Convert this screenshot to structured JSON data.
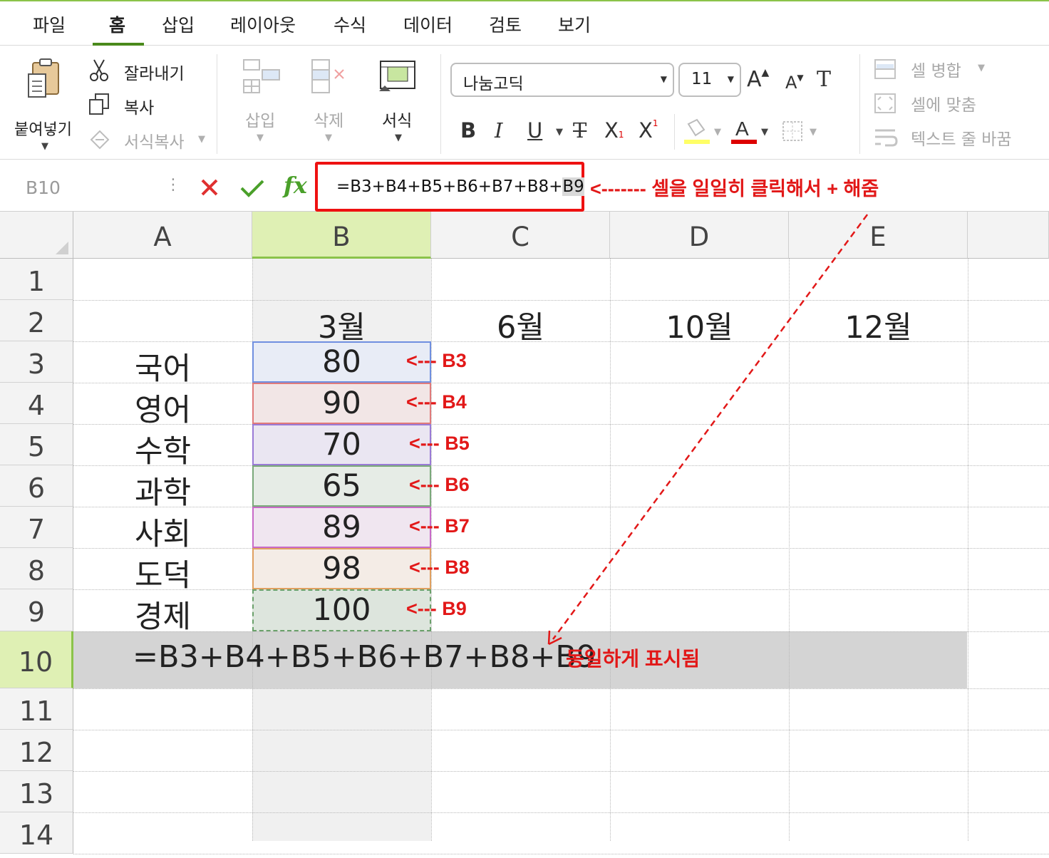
{
  "tabs": [
    {
      "label": "파일"
    },
    {
      "label": "홈",
      "active": true
    },
    {
      "label": "삽입"
    },
    {
      "label": "레이아웃"
    },
    {
      "label": "수식"
    },
    {
      "label": "데이터"
    },
    {
      "label": "검토"
    },
    {
      "label": "보기"
    }
  ],
  "ribbon": {
    "paste_label": "붙여넣기",
    "cut_label": "잘라내기",
    "copy_label": "복사",
    "format_painter_label": "서식복사",
    "insert_label": "삽입",
    "delete_label": "삭제",
    "format_label": "서식",
    "font_name": "나눔고딕",
    "font_size": "11",
    "merge_label": "셀 병합",
    "fit_label": "셀에 맞춤",
    "wrap_label": "텍스트 줄 바꿈",
    "fill_color": "#ffff66",
    "font_color": "#dd0000"
  },
  "formula_bar": {
    "name_box": "B10",
    "formula_main": "=B3+B4+B5+B6+B7+B8+",
    "formula_last": "B9",
    "annotation": "<------- 셀을 일일히 클릭해서 + 해줌"
  },
  "grid": {
    "columns": [
      "A",
      "B",
      "C",
      "D",
      "E"
    ],
    "rows": [
      "1",
      "2",
      "3",
      "4",
      "5",
      "6",
      "7",
      "8",
      "9",
      "10",
      "11",
      "12",
      "13",
      "14"
    ],
    "header_row": [
      "3월",
      "6월",
      "10월",
      "12월"
    ],
    "subjects": [
      "국어",
      "영어",
      "수학",
      "과학",
      "사회",
      "도덕",
      "경제"
    ],
    "scores": [
      "80",
      "90",
      "70",
      "65",
      "89",
      "98",
      "100"
    ],
    "ref_labels": [
      "<--- B3",
      "<--- B4",
      "<--- B5",
      "<--- B6",
      "<--- B7",
      "<--- B8",
      "<--- B9"
    ],
    "ref_colors": [
      "#6f8fe0",
      "#e07a7a",
      "#9a7ad6",
      "#7aa97a",
      "#c86ac8",
      "#e0a060",
      "#6aa06a"
    ],
    "ref_fills": [
      "#e8ecf6",
      "#f2e6e6",
      "#eae6f2",
      "#e6ece6",
      "#f0e6f0",
      "#f4ece6",
      "#dde5dd"
    ],
    "row10_formula": "=B3+B4+B5+B6+B7+B8+B9",
    "row10_annotation": "동일하게 표시됨"
  },
  "colors": {
    "accent_green": "#8bc34a",
    "annotation_red": "#e21818"
  }
}
